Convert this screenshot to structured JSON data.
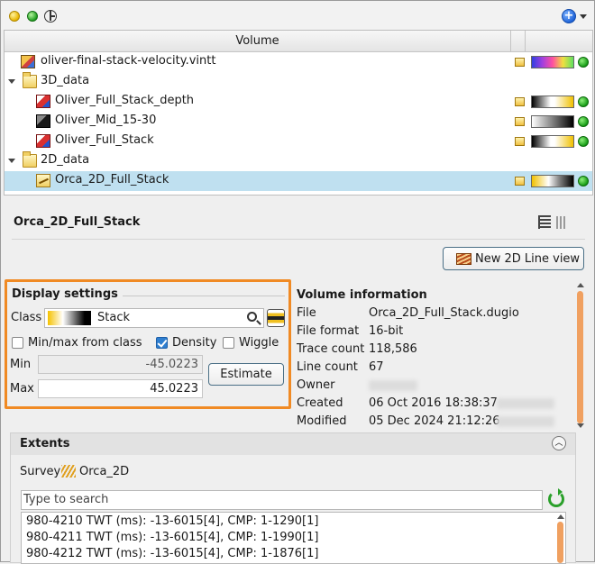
{
  "tree": {
    "header": "Volume",
    "rows": [
      {
        "label": "oliver-final-stack-velocity.vintt",
        "icon": "velocity-cube-icon",
        "colorbar": "linear-gradient(90deg,#3040e0,#a040e0,#ff50a0,#f0e040,#60e060)"
      },
      {
        "label": "3D_data",
        "icon": "folder-icon"
      },
      {
        "label": "Oliver_Full_Stack_depth",
        "icon": "seismic-cube-icon",
        "colorbar": "linear-gradient(90deg,#000 0%,#fff 45%,#fff 55%,#f0c000 100%)"
      },
      {
        "label": "Oliver_Mid_15-30",
        "icon": "grayscale-cube-icon",
        "colorbar": "linear-gradient(90deg,#fff 0%,#000 100%)"
      },
      {
        "label": "Oliver_Full_Stack",
        "icon": "seismic-cube-icon",
        "colorbar": "linear-gradient(90deg,#000 0%,#fff 45%,#fff 55%,#f0c000 100%)"
      },
      {
        "label": "2D_data",
        "icon": "folder-icon"
      },
      {
        "label": "Orca_2D_Full_Stack",
        "icon": "2d-line-icon",
        "colorbar": "linear-gradient(90deg,#f0c000 0%,#fff 40%,#888 65%,#000 100%)"
      }
    ]
  },
  "detail": {
    "title": "Orca_2D_Full_Stack",
    "new_view_label": "New 2D Line view"
  },
  "display_settings": {
    "title": "Display settings",
    "class_label": "Class",
    "class_value": "Stack",
    "minmax_label": "Min/max from class",
    "density_label": "Density",
    "wiggle_label": "Wiggle",
    "minmax_checked": false,
    "density_checked": true,
    "wiggle_checked": false,
    "min_label": "Min",
    "min_value": "-45.0223",
    "max_label": "Max",
    "max_value": "45.0223",
    "estimate_label": "Estimate"
  },
  "volume_info": {
    "title": "Volume information",
    "rows": [
      {
        "key": "File",
        "value": "Orca_2D_Full_Stack.dugio"
      },
      {
        "key": "File format",
        "value": "16-bit"
      },
      {
        "key": "Trace count",
        "value": "118,586"
      },
      {
        "key": "Line count",
        "value": "67"
      },
      {
        "key": "Owner",
        "value": ""
      },
      {
        "key": "Created",
        "value": "06 Oct 2016 18:38:37"
      },
      {
        "key": "Modified",
        "value": "05 Dec 2024 21:12:26"
      }
    ]
  },
  "extents": {
    "title": "Extents",
    "survey_label": "Survey",
    "survey_value": "Orca_2D",
    "search_placeholder": "Type to search",
    "items": [
      "980-4210 TWT (ms): -13-6015[4], CMP: 1-1290[1]",
      "980-4211 TWT (ms): -13-6015[4], CMP: 1-1990[1]",
      "980-4212 TWT (ms): -13-6015[4], CMP: 1-1876[1]"
    ]
  },
  "colors": {
    "accent_orange": "#f08a24",
    "selection": "#bfe0f0",
    "status_green": "#149a14"
  }
}
